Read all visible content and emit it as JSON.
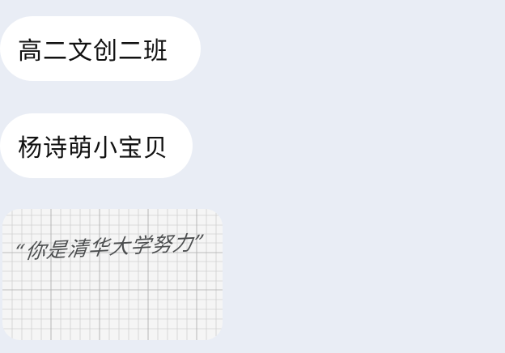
{
  "messages": [
    {
      "type": "text",
      "text": "高二文创二班"
    },
    {
      "type": "text",
      "text": "杨诗萌小宝贝"
    },
    {
      "type": "image",
      "handwritten_text": "“你是清华大学努力”"
    }
  ],
  "colors": {
    "background": "#e9edf5",
    "bubble": "#ffffff",
    "text": "#111111",
    "grid_paper": "#f3f3f3",
    "grid_lines": "#8a8a8a",
    "handwriting": "#3f4143"
  }
}
